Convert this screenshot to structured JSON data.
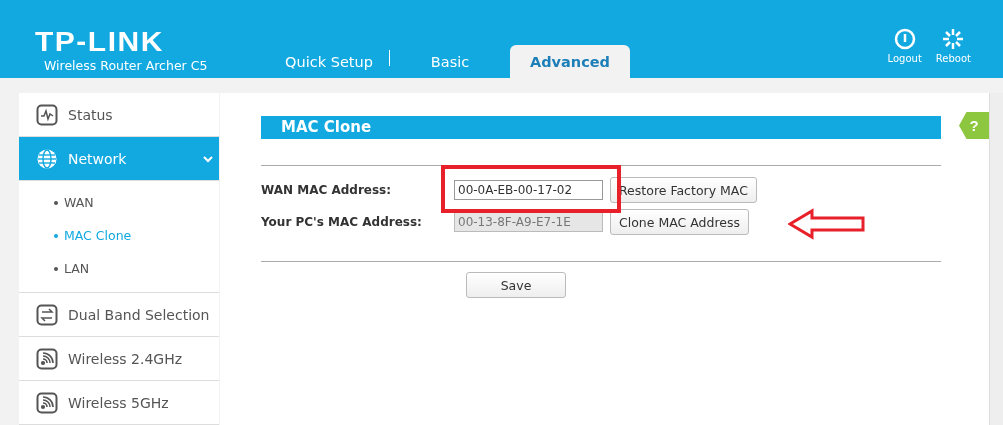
{
  "header": {
    "logo": "TP-LINK",
    "subtitle": "Wireless Router Archer C5"
  },
  "tabs": [
    {
      "label": "Quick Setup",
      "selected": false
    },
    {
      "label": "Basic",
      "selected": false
    },
    {
      "label": "Advanced",
      "selected": true
    }
  ],
  "actions": [
    {
      "label": "Logout",
      "kind": "power"
    },
    {
      "label": "Reboot",
      "kind": "reboot"
    }
  ],
  "sidebar": {
    "items": [
      {
        "label": "Status",
        "kind": "status",
        "selected": false
      },
      {
        "label": "Network",
        "kind": "globe",
        "selected": true,
        "expanded": true,
        "children": [
          {
            "label": "WAN",
            "selected": false
          },
          {
            "label": "MAC Clone",
            "selected": true
          },
          {
            "label": "LAN",
            "selected": false
          }
        ]
      },
      {
        "label": "Dual Band Selection",
        "kind": "swap",
        "selected": false
      },
      {
        "label": "Wireless 2.4GHz",
        "kind": "wifi",
        "selected": false
      },
      {
        "label": "Wireless 5GHz",
        "kind": "wifi",
        "selected": false
      }
    ]
  },
  "content": {
    "title": "MAC Clone",
    "help": "?",
    "fields": [
      {
        "label": "WAN MAC Address:",
        "value": "00-0A-EB-00-17-02",
        "disabled": false,
        "button": "Restore Factory MAC"
      },
      {
        "label": "Your PC's MAC Address:",
        "value": "00-13-8F-A9-E7-1E",
        "disabled": true,
        "button": "Clone MAC Address"
      }
    ],
    "save_button": "Save"
  }
}
